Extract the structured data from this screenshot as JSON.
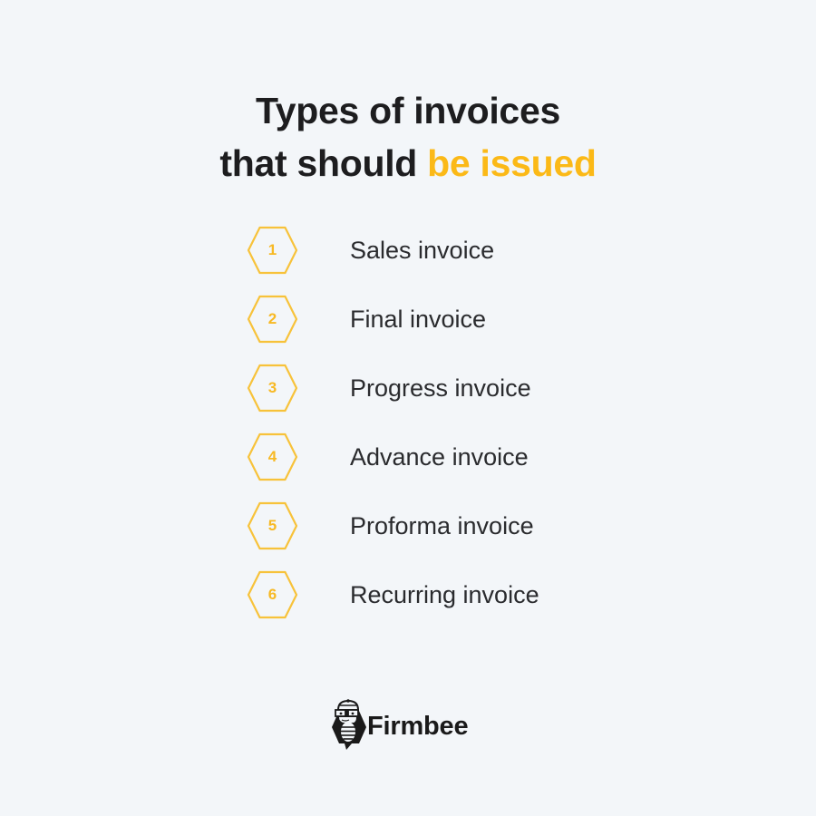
{
  "header": {
    "title_line1": "Types of invoices",
    "title_line2_plain": "that should ",
    "title_line2_accent": "be issued"
  },
  "colors": {
    "accent": "#fbb917",
    "text_dark": "#1d1d1f",
    "background": "#f3f6f9"
  },
  "invoice_types": [
    {
      "number": "1",
      "label": "Sales invoice",
      "icon": "hexagon-badge"
    },
    {
      "number": "2",
      "label": "Final invoice",
      "icon": "hexagon-badge"
    },
    {
      "number": "3",
      "label": "Progress invoice",
      "icon": "hexagon-badge"
    },
    {
      "number": "4",
      "label": "Advance invoice",
      "icon": "hexagon-badge"
    },
    {
      "number": "5",
      "label": "Proforma invoice",
      "icon": "hexagon-badge"
    },
    {
      "number": "6",
      "label": "Recurring invoice",
      "icon": "hexagon-badge"
    }
  ],
  "footer": {
    "brand_name": "Firmbee",
    "logo_icon": "bee-mascot-icon"
  }
}
